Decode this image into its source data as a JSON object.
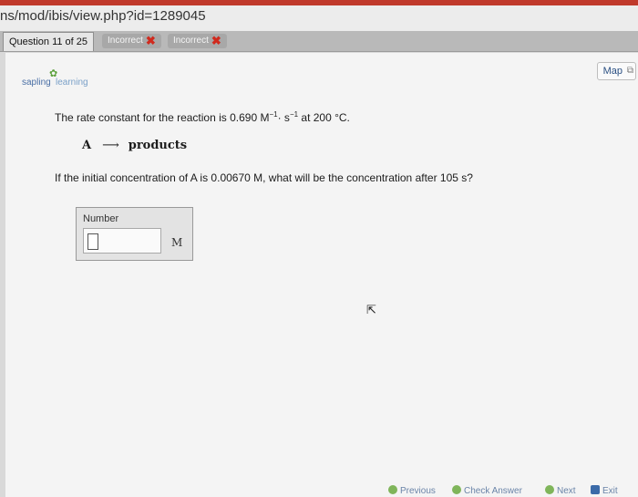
{
  "browser": {
    "url": "ns/mod/ibis/view.php?id=1289045"
  },
  "tabs": {
    "question_tab": "Question 11 of 25",
    "status": [
      "Incorrect",
      "Incorrect"
    ]
  },
  "map_button": "Map",
  "logo": {
    "word1": "sapling",
    "word2": "learning"
  },
  "question": {
    "rate_prefix": "The rate constant for the reaction is 0.690 M",
    "exp1": "−1",
    "mid": "· s",
    "exp2": "−1",
    "rate_suffix": " at 200 °C.",
    "reaction_left": "A",
    "reaction_arrow": "⟶",
    "reaction_right": "products",
    "prompt": "If the initial concentration of A is 0.00670 M, what will be the concentration after 105 s?"
  },
  "answer": {
    "label": "Number",
    "value": "",
    "unit": "M"
  },
  "bottom_nav": {
    "previous": "Previous",
    "check": "Check Answer",
    "next": "Next",
    "exit": "Exit"
  },
  "colors": {
    "incorrect": "#d02a1e",
    "link": "#2a4f82",
    "nav_icon": "#7fb55a"
  }
}
